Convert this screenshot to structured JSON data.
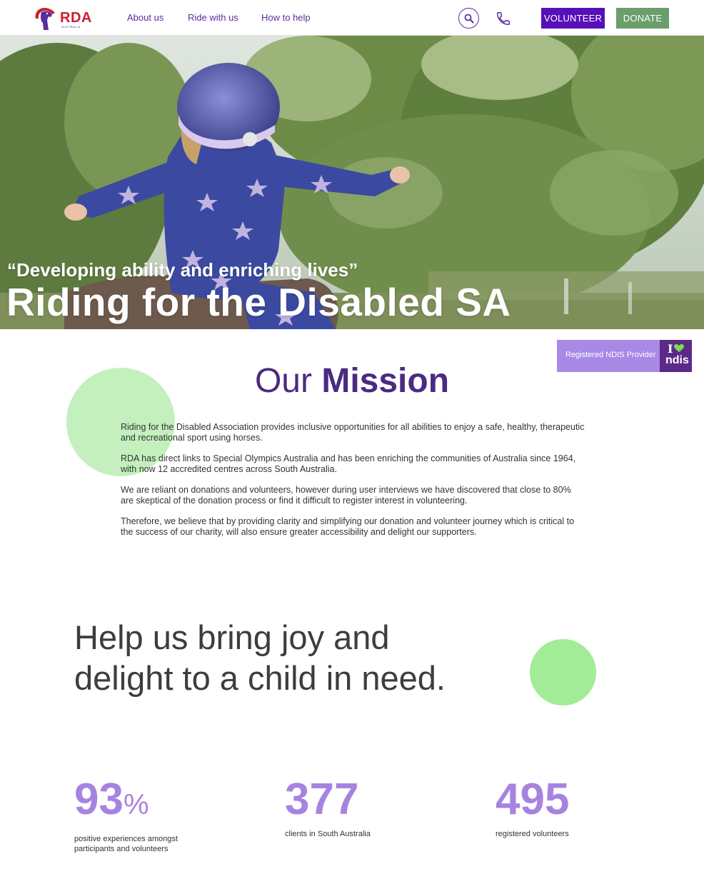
{
  "nav": {
    "logo_text": "RDA",
    "logo_subtext": "AUSTRALIA",
    "links": [
      "About us",
      "Ride with us",
      "How to help"
    ],
    "search_icon": "search-icon",
    "phone_icon": "phone-icon",
    "volunteer_label": "VOLUNTEER",
    "donate_label": "DONATE"
  },
  "hero": {
    "quote": "“Developing ability and enriching lives”",
    "title": "Riding for the Disabled SA"
  },
  "ndis": {
    "label": "Registered NDIS Provider",
    "logo_i": "I",
    "logo_word": "ndis"
  },
  "mission": {
    "title_light": "Our ",
    "title_bold": "Mission",
    "paragraphs": [
      "Riding for the Disabled Association provides inclusive opportunities for all abilities to enjoy a safe, healthy, therapeutic and recreational sport using horses.",
      "RDA has direct links to Special Olympics Australia and has been enriching the communities of Australia since 1964, with now 12 accredited centres across South Australia.",
      "We are reliant on donations and volunteers, however during user interviews we have discovered that close to 80% are skeptical of the donation process or find it difficult to register interest in volunteering.",
      "Therefore, we believe that by providing clarity and simplifying our donation and volunteer journey which is critical to the success of our charity, will also ensure greater accessibility and delight our supporters."
    ]
  },
  "help": {
    "heading": "Help us bring joy and delight to a child in need."
  },
  "stats": [
    {
      "number": "93",
      "suffix": "%",
      "label": "positive experiences amongst participants and volunteers"
    },
    {
      "number": "377",
      "suffix": "",
      "label": "clients in South Australia"
    },
    {
      "number": "495",
      "suffix": "",
      "label": "registered volunteers"
    }
  ],
  "colors": {
    "purple": "#5a2ca0",
    "volunteer_bg": "#5710b8",
    "donate_bg": "#6a9e6a",
    "stat_purple": "#a783e0",
    "green_circle": "#c3f0bd",
    "ndis_bg": "#a889e6"
  }
}
